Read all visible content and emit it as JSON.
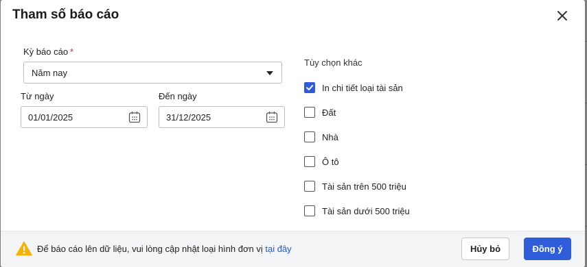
{
  "dialog": {
    "title": "Tham số báo cáo"
  },
  "form": {
    "period_label": "Kỳ báo cáo",
    "period_required_mark": "*",
    "period_value": "Năm nay",
    "from_label": "Từ ngày",
    "from_value": "01/01/2025",
    "to_label": "Đến ngày",
    "to_value": "31/12/2025"
  },
  "options": {
    "title": "Tùy chọn khác",
    "items": [
      {
        "label": "In chi tiết loại tài sản",
        "checked": true
      },
      {
        "label": "Đất",
        "checked": false
      },
      {
        "label": "Nhà",
        "checked": false
      },
      {
        "label": "Ô tô",
        "checked": false
      },
      {
        "label": "Tài sản trên 500 triệu",
        "checked": false
      },
      {
        "label": "Tài sản dưới 500 triệu",
        "checked": false
      }
    ]
  },
  "footer": {
    "warning_text": "Để báo cáo lên dữ liệu, vui lòng cập nhật loại hình đơn vị",
    "warning_link": "tại đây",
    "cancel_label": "Hủy bỏ",
    "ok_label": "Đồng ý"
  },
  "icons": {
    "close": "close-icon",
    "calendar": "calendar-icon",
    "warning": "warning-icon",
    "dropdown": "caret-down-icon",
    "check": "check-icon"
  },
  "colors": {
    "accent": "#2f5cd9",
    "required": "#e02424",
    "warning": "#f5b301",
    "link": "#1f5bd6"
  }
}
